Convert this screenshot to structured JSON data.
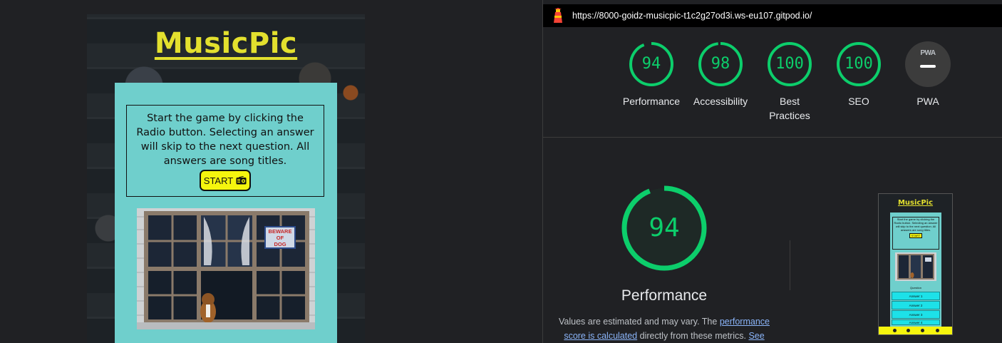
{
  "app": {
    "title": "MusicPic",
    "instructions": "Start the game by clicking the Radio button. Selecting an answer will skip to the next question. All answers are song titles.",
    "start_label": "START",
    "image_sign_text": "BEWARE OF DOG"
  },
  "lighthouse": {
    "url": "https://8000-goidz-musicpic-t1c2g27od3i.ws-eu107.gitpod.io/",
    "scores": [
      {
        "label": "Performance",
        "value": "94"
      },
      {
        "label": "Accessibility",
        "value": "98"
      },
      {
        "label": "Best Practices",
        "value": "100"
      },
      {
        "label": "SEO",
        "value": "100"
      }
    ],
    "pwa": {
      "label": "PWA",
      "badge_text": "PWA"
    },
    "main_score": {
      "value": "94",
      "label": "Performance"
    },
    "description": {
      "prefix": "Values are estimated and may vary. The ",
      "link1": "performance score is calculated",
      "middle": " directly from these metrics. ",
      "link2": "See"
    },
    "thumbnail": {
      "title": "MusicPic",
      "instructions": "Start the game by clicking the Radio button. Selecting an answer will skip to the next question. All answers are song titles.",
      "start": "START",
      "question": "Question",
      "answers": [
        "Answer 1",
        "Answer 2",
        "Answer 3",
        "Answer 4"
      ]
    }
  },
  "colors": {
    "score_green": "#0cce6b",
    "app_title_yellow": "#e3e02e",
    "card_teal": "#6fcfcc",
    "start_yellow": "#f5f50e",
    "answer_cyan": "#1de1e8"
  }
}
